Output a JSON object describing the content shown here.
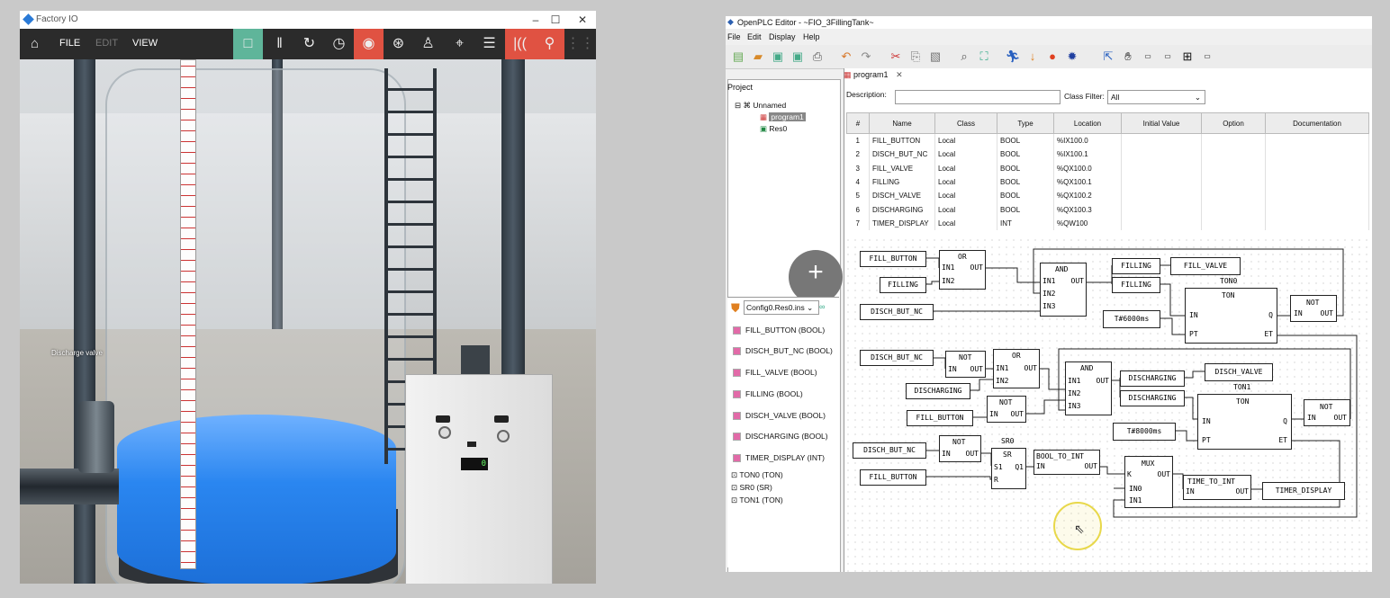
{
  "fio": {
    "title": "Factory IO",
    "window_min": "–",
    "window_max": "☐",
    "window_close": "✕",
    "menu": [
      "FILE",
      "EDIT",
      "VIEW"
    ],
    "scene_label": "Discharge valve",
    "display_value": "0"
  },
  "plc": {
    "title": "OpenPLC Editor - ~FIO_3FillingTank~",
    "menu": [
      "File",
      "Edit",
      "Display",
      "Help"
    ],
    "project_tab": "Project",
    "tree": {
      "root": "Unnamed",
      "program": "program1",
      "res": "Res0"
    },
    "config_selector": "Config0.Res0.ins",
    "var_items": [
      "FILL_BUTTON (BOOL)",
      "DISCH_BUT_NC (BOOL)",
      "FILL_VALVE (BOOL)",
      "FILLING (BOOL)",
      "DISCH_VALVE (BOOL)",
      "DISCHARGING (BOOL)",
      "TIMER_DISPLAY (INT)"
    ],
    "fb_items": [
      "TON0 (TON)",
      "SR0 (SR)",
      "TON1 (TON)"
    ],
    "editor_tab": "program1",
    "description_label": "Description:",
    "class_filter_label": "Class Filter:",
    "class_filter_value": "All",
    "columns": [
      "#",
      "Name",
      "Class",
      "Type",
      "Location",
      "Initial Value",
      "Option",
      "Documentation"
    ],
    "rows": [
      [
        "1",
        "FILL_BUTTON",
        "Local",
        "BOOL",
        "%IX100.0",
        "",
        "",
        ""
      ],
      [
        "2",
        "DISCH_BUT_NC",
        "Local",
        "BOOL",
        "%IX100.1",
        "",
        "",
        ""
      ],
      [
        "3",
        "FILL_VALVE",
        "Local",
        "BOOL",
        "%QX100.0",
        "",
        "",
        ""
      ],
      [
        "4",
        "FILLING",
        "Local",
        "BOOL",
        "%QX100.1",
        "",
        "",
        ""
      ],
      [
        "5",
        "DISCH_VALVE",
        "Local",
        "BOOL",
        "%QX100.2",
        "",
        "",
        ""
      ],
      [
        "6",
        "DISCHARGING",
        "Local",
        "BOOL",
        "%QX100.3",
        "",
        "",
        ""
      ],
      [
        "7",
        "TIMER_DISPLAY",
        "Local",
        "INT",
        "%QW100",
        "",
        "",
        ""
      ]
    ],
    "fbd": {
      "fill_button": "FILL_BUTTON",
      "filling": "FILLING",
      "disch_but_nc": "DISCH_BUT_NC",
      "fill_valve": "FILL_VALVE",
      "disch_valve": "DISCH_VALVE",
      "discharging": "DISCHARGING",
      "timer_display": "TIMER_DISPLAY",
      "t6000": "T#6000ms",
      "t8000": "T#8000ms",
      "or": "OR",
      "and": "AND",
      "not": "NOT",
      "ton": "TON",
      "sr": "SR",
      "mux": "MUX",
      "ton0": "TON0",
      "ton1": "TON1",
      "sr0": "SR0",
      "bool_to_int": "BOOL_TO_INT",
      "time_to_int": "TIME_TO_INT",
      "in1": "IN1",
      "in2": "IN2",
      "in3": "IN3",
      "out": "OUT",
      "in": "IN",
      "q": "Q",
      "pt": "PT",
      "et": "ET",
      "s1": "S1",
      "q1": "Q1",
      "r": "R",
      "k": "K",
      "in0": "IN0",
      "in1m": "IN1"
    }
  }
}
